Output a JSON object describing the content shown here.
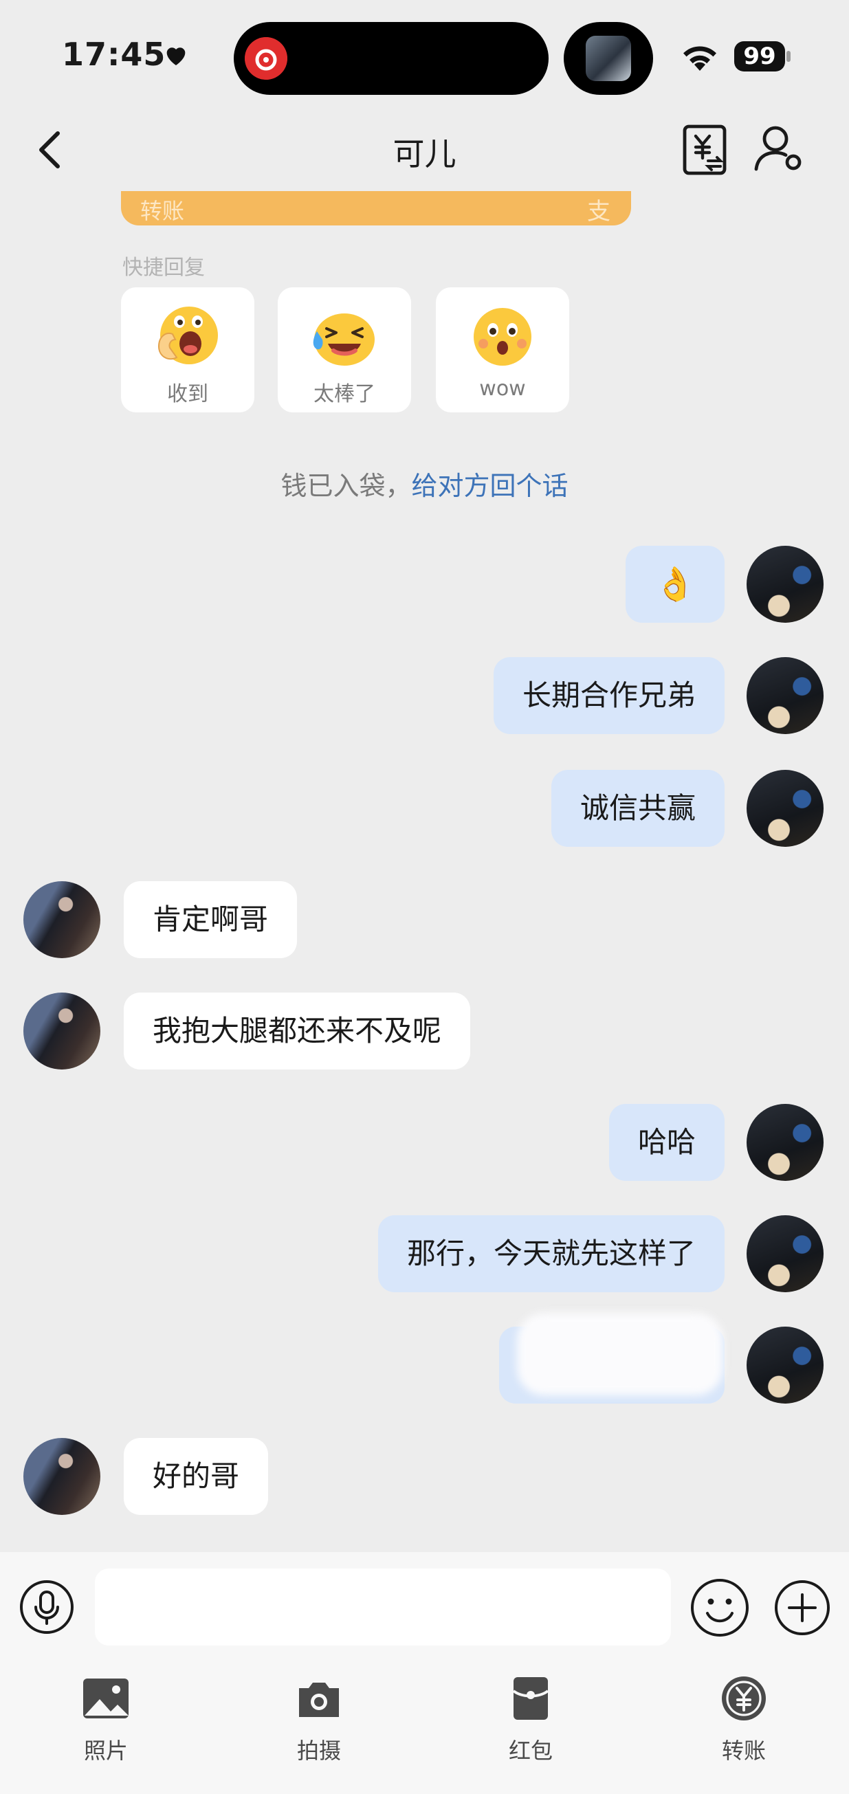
{
  "status_bar": {
    "time": "17:45",
    "battery": "99"
  },
  "header": {
    "title": "可儿"
  },
  "transfer_card": {
    "label": "转账",
    "icon_char": "支"
  },
  "quick_reply": {
    "label": "快捷回复",
    "options": [
      {
        "label": "收到",
        "emoji": "ok-hand-face"
      },
      {
        "label": "太棒了",
        "emoji": "laughing-tears-face"
      },
      {
        "label": "wow",
        "emoji": "surprised-face"
      }
    ]
  },
  "notice": {
    "text": "钱已入袋，",
    "link": "给对方回个话"
  },
  "messages": [
    {
      "sender": "me",
      "text": "👌"
    },
    {
      "sender": "me",
      "text": "长期合作兄弟"
    },
    {
      "sender": "me",
      "text": "诚信共赢"
    },
    {
      "sender": "other",
      "text": "肯定啊哥"
    },
    {
      "sender": "other",
      "text": "我抱大腿都还来不及呢"
    },
    {
      "sender": "me",
      "text": "哈哈"
    },
    {
      "sender": "me",
      "text": "那行，今天就先这样了"
    },
    {
      "sender": "me",
      "text": ""
    },
    {
      "sender": "other",
      "text": "好的哥"
    }
  ],
  "input": {
    "value": "",
    "placeholder": ""
  },
  "toolbar": {
    "items": [
      {
        "label": "照片",
        "icon": "photo-icon"
      },
      {
        "label": "拍摄",
        "icon": "camera-icon"
      },
      {
        "label": "红包",
        "icon": "red-packet-icon"
      },
      {
        "label": "转账",
        "icon": "transfer-icon"
      }
    ]
  },
  "colors": {
    "background": "#ededed",
    "my_bubble": "#d8e6fa",
    "other_bubble": "#ffffff",
    "link": "#3d73b8",
    "transfer_card": "#f5b95d"
  }
}
